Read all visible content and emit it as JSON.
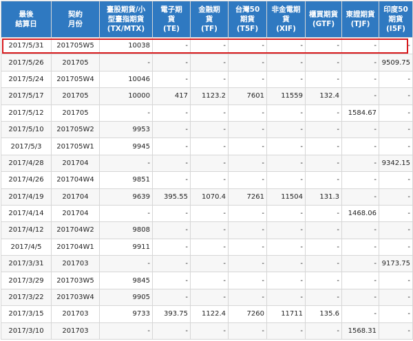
{
  "accent_color": "#2f79c1",
  "highlight_color": "#d7191c",
  "headers": [
    "最後\n結算日",
    "契約\n月份",
    "臺股期貨/小\n型臺指期貨\n(TX/MTX)",
    "電子期\n貨\n(TE)",
    "金融期\n貨\n(TF)",
    "台灣50\n期貨\n(T5F)",
    "非金電期\n貨\n(XIF)",
    "櫃買期貨\n(GTF)",
    "東證期貨\n(TJF)",
    "印度50\n期貨\n(I5F)"
  ],
  "rows": [
    [
      "2017/5/31",
      "201705W5",
      "10038",
      "-",
      "-",
      "-",
      "-",
      "-",
      "-",
      "-"
    ],
    [
      "2017/5/26",
      "201705",
      "-",
      "-",
      "-",
      "-",
      "-",
      "-",
      "-",
      "9509.75"
    ],
    [
      "2017/5/24",
      "201705W4",
      "10046",
      "-",
      "-",
      "-",
      "-",
      "-",
      "-",
      "-"
    ],
    [
      "2017/5/17",
      "201705",
      "10000",
      "417",
      "1123.2",
      "7601",
      "11559",
      "132.4",
      "-",
      "-"
    ],
    [
      "2017/5/12",
      "201705",
      "-",
      "-",
      "-",
      "-",
      "-",
      "-",
      "1584.67",
      "-"
    ],
    [
      "2017/5/10",
      "201705W2",
      "9953",
      "-",
      "-",
      "-",
      "-",
      "-",
      "-",
      "-"
    ],
    [
      "2017/5/3",
      "201705W1",
      "9945",
      "-",
      "-",
      "-",
      "-",
      "-",
      "-",
      "-"
    ],
    [
      "2017/4/28",
      "201704",
      "-",
      "-",
      "-",
      "-",
      "-",
      "-",
      "-",
      "9342.15"
    ],
    [
      "2017/4/26",
      "201704W4",
      "9851",
      "-",
      "-",
      "-",
      "-",
      "-",
      "-",
      "-"
    ],
    [
      "2017/4/19",
      "201704",
      "9639",
      "395.55",
      "1070.4",
      "7261",
      "11504",
      "131.3",
      "-",
      "-"
    ],
    [
      "2017/4/14",
      "201704",
      "-",
      "-",
      "-",
      "-",
      "-",
      "-",
      "1468.06",
      "-"
    ],
    [
      "2017/4/12",
      "201704W2",
      "9808",
      "-",
      "-",
      "-",
      "-",
      "-",
      "-",
      "-"
    ],
    [
      "2017/4/5",
      "201704W1",
      "9911",
      "-",
      "-",
      "-",
      "-",
      "-",
      "-",
      "-"
    ],
    [
      "2017/3/31",
      "201703",
      "-",
      "-",
      "-",
      "-",
      "-",
      "-",
      "-",
      "9173.75"
    ],
    [
      "2017/3/29",
      "201703W5",
      "9845",
      "-",
      "-",
      "-",
      "-",
      "-",
      "-",
      "-"
    ],
    [
      "2017/3/22",
      "201703W4",
      "9905",
      "-",
      "-",
      "-",
      "-",
      "-",
      "-",
      "-"
    ],
    [
      "2017/3/15",
      "201703",
      "9733",
      "393.75",
      "1122.4",
      "7260",
      "11711",
      "135.6",
      "-",
      "-"
    ],
    [
      "2017/3/10",
      "201703",
      "-",
      "-",
      "-",
      "-",
      "-",
      "-",
      "1568.31",
      "-"
    ]
  ]
}
